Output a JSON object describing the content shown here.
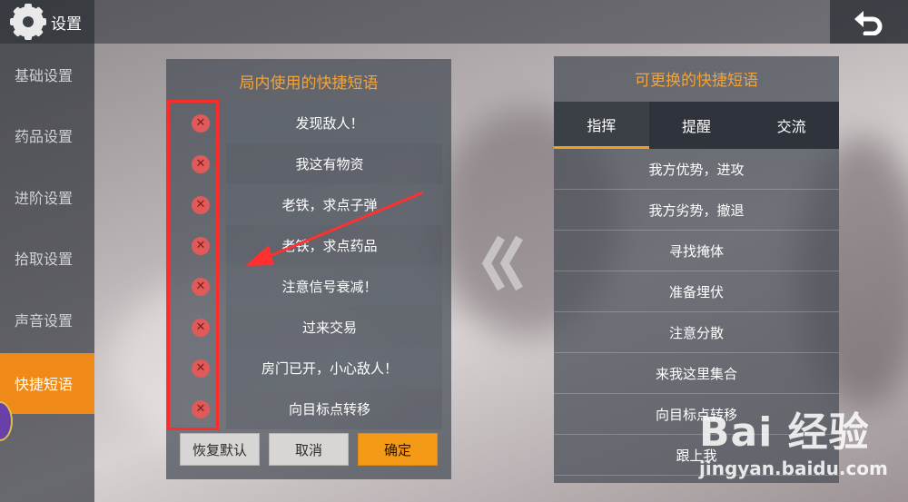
{
  "header": {
    "title": "设置"
  },
  "sidebar": {
    "items": [
      {
        "label": "基础设置"
      },
      {
        "label": "药品设置"
      },
      {
        "label": "进阶设置"
      },
      {
        "label": "拾取设置"
      },
      {
        "label": "声音设置"
      },
      {
        "label": "快捷短语"
      }
    ]
  },
  "left_panel": {
    "title": "局内使用的快捷短语",
    "delete_icon": "close-circle-icon",
    "phrases": [
      "发现敌人！",
      "我这有物资",
      "老铁，求点子弹",
      "老铁，求点药品",
      "注意信号衰减！",
      "过来交易",
      "房门已开，小心敌人！",
      "向目标点转移"
    ],
    "buttons": {
      "reset": "恢复默认",
      "cancel": "取消",
      "confirm": "确定"
    }
  },
  "right_panel": {
    "title": "可更换的快捷短语",
    "tabs": [
      "指挥",
      "提醒",
      "交流"
    ],
    "phrases": [
      "我方优势，进攻",
      "我方劣势，撤退",
      "寻找掩体",
      "准备埋伏",
      "注意分散",
      "来我这里集合",
      "向目标点转移",
      "跟上我"
    ]
  },
  "watermark": {
    "logo": "Bai 经验",
    "url": "jingyan.baidu.com"
  },
  "colors": {
    "accent": "#f59a16",
    "title_orange": "#f2a43a",
    "highlight_red": "#ff2b2b"
  }
}
